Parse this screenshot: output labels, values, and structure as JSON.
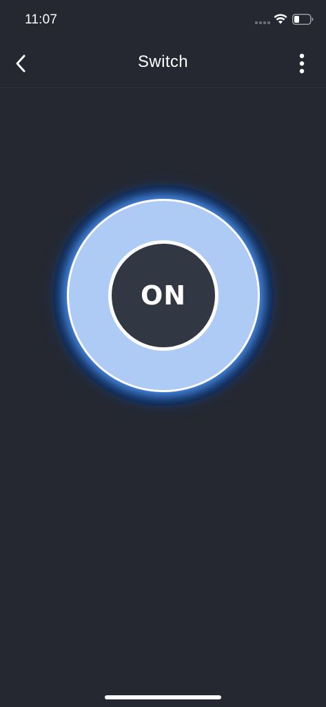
{
  "status_bar": {
    "time": "11:07",
    "icons": [
      "cellular-signal-icon",
      "wifi-icon",
      "battery-icon"
    ]
  },
  "nav": {
    "title": "Switch",
    "back_icon": "chevron-left-icon",
    "more_icon": "more-vertical-icon"
  },
  "switch": {
    "label": "ON",
    "state": "on"
  },
  "colors": {
    "background": "#252831",
    "ring_on": "#aecbf6",
    "glow": "#5aa0ff",
    "button_fill": "#323744",
    "text": "#ffffff"
  }
}
